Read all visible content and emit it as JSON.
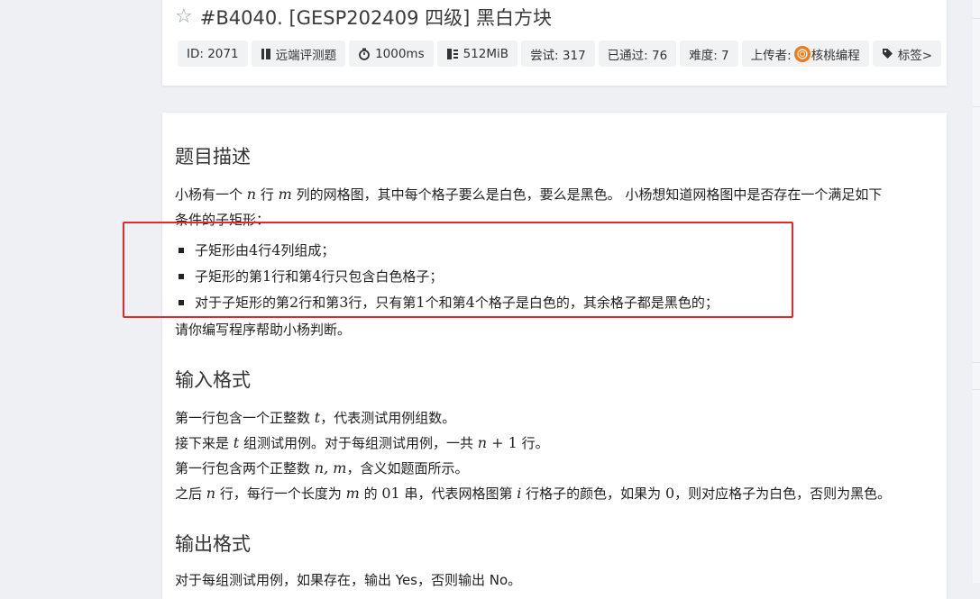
{
  "problem": {
    "title": "#B4040. [GESP202409 四级] 黑白方块",
    "badges": [
      {
        "label": "ID: 2071",
        "icon": null
      },
      {
        "label": "远端评测题",
        "icon": "bookmark-icon"
      },
      {
        "label": "1000ms",
        "icon": "stopwatch-icon"
      },
      {
        "label": "512MiB",
        "icon": "memory-icon"
      },
      {
        "label": "尝试: 317",
        "icon": null
      },
      {
        "label": "已通过: 76",
        "icon": null
      },
      {
        "label": "难度: 7",
        "icon": null
      },
      {
        "label_prefix": "上传者:",
        "uploader": "核桃编程",
        "icon": "avatar"
      },
      {
        "label": "标签>",
        "icon": "tag-icon"
      }
    ]
  },
  "sections": {
    "description": {
      "heading": "题目描述",
      "intro_line1": {
        "a": "小杨有一个 ",
        "n": "n",
        "b": " 行 ",
        "m": "m",
        "c": " 列的网格图，其中每个格子要么是白色，要么是黑色。 小杨想知道网格图中是否存在一个满足如下"
      },
      "intro_line2": "条件的子矩形：",
      "bullets": [
        {
          "a": "子矩形由 ",
          "x": "4",
          "b": " 行 ",
          "y": "4",
          "c": " 列组成；"
        },
        {
          "a": "子矩形的第 ",
          "x": "1",
          "b": " 行和第 ",
          "y": "4",
          "c": " 行只包含白色格子；"
        },
        {
          "a": "对于子矩形的第 ",
          "x": "2",
          "b": " 行和第 ",
          "y": "3",
          "c": " 行，只有第 ",
          "z": "1",
          "d": " 个和第 ",
          "w": "4",
          "e": " 个格子是白色的，其余格子都是黑色的；"
        }
      ],
      "closing": "请你编写程序帮助小杨判断。"
    },
    "input": {
      "heading": "输入格式",
      "line1": {
        "a": "第一行包含一个正整数 ",
        "t": "t",
        "b": "，代表测试用例组数。"
      },
      "line2": {
        "a": "接下来是 ",
        "t": "t",
        "b": " 组测试用例。对于每组测试用例，一共 ",
        "expr_n": "n",
        "expr_op": " + ",
        "expr_1": "1",
        "c": " 行。"
      },
      "line3": {
        "a": "第一行包含两个正整数 ",
        "vars": "n, m",
        "b": "，含义如题面所示。"
      },
      "line4": {
        "a": "之后 ",
        "n": "n",
        "b": " 行，每行一个长度为 ",
        "m": "m",
        "c": " 的 ",
        "z": "01",
        "d": " 串，代表网格图第 ",
        "i": "i",
        "e": " 行格子的颜色，如果为 ",
        "zero": "0",
        "f": "，则对应格子为白色，否则为黑色。"
      }
    },
    "output": {
      "heading": "输出格式",
      "line1": "对于每组测试用例，如果存在，输出 Yes，否则输出 No。"
    }
  },
  "colors": {
    "highlight_border": "#e5262b",
    "avatar": "#f07a1a",
    "badge_bg": "#f1f2f4"
  }
}
